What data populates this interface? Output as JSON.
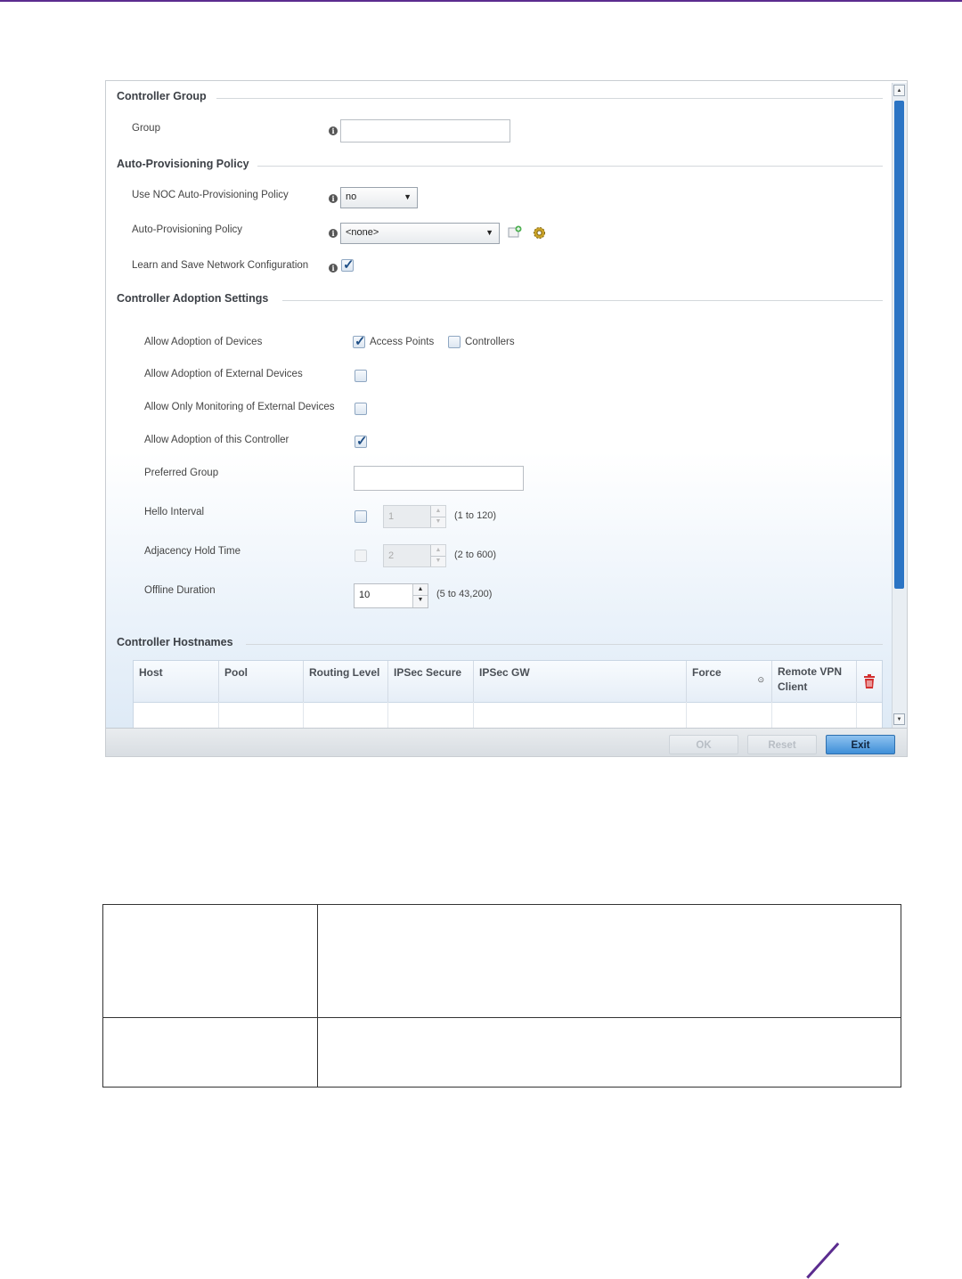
{
  "sections": {
    "controller_group": "Controller Group",
    "auto_provisioning": "Auto-Provisioning Policy",
    "adoption_settings": "Controller Adoption Settings",
    "hostnames": "Controller Hostnames"
  },
  "controller_group": {
    "group_label": "Group",
    "group_value": ""
  },
  "auto_provisioning": {
    "use_noc_label": "Use NOC Auto-Provisioning Policy",
    "use_noc_value": "no",
    "policy_label": "Auto-Provisioning Policy",
    "policy_value": "<none>",
    "learn_label": "Learn and Save Network Configuration",
    "learn_checked": true
  },
  "adoption": {
    "allow_devices_label": "Allow Adoption of Devices",
    "access_points_label": "Access Points",
    "access_points_checked": true,
    "controllers_label": "Controllers",
    "controllers_checked": false,
    "allow_external_label": "Allow Adoption of External Devices",
    "allow_external_checked": false,
    "monitor_external_label": "Allow Only Monitoring of External Devices",
    "monitor_external_checked": false,
    "allow_this_label": "Allow Adoption of this Controller",
    "allow_this_checked": true,
    "preferred_group_label": "Preferred Group",
    "preferred_group_value": "",
    "hello_label": "Hello Interval",
    "hello_value": "1",
    "hello_range": "(1 to 120)",
    "adjacency_label": "Adjacency Hold Time",
    "adjacency_value": "2",
    "adjacency_range": "(2 to 600)",
    "offline_label": "Offline Duration",
    "offline_value": "10",
    "offline_range": "(5 to 43,200)"
  },
  "hostnames_table": {
    "columns": [
      "Host",
      "Pool",
      "Routing Level",
      "IPSec Secure",
      "IPSec GW",
      "Force",
      "Remote VPN Client"
    ],
    "rows": []
  },
  "footer": {
    "ok_label": "OK",
    "reset_label": "Reset",
    "exit_label": "Exit"
  },
  "colors": {
    "accent": "#5b2c8f",
    "scrollbar": "#2b74c4",
    "exit_button": "#3f8fd8"
  },
  "icons": [
    "info-icon",
    "add-policy-icon",
    "configure-gear-icon",
    "delete-trash-icon",
    "scroll-up-icon",
    "scroll-down-icon"
  ]
}
